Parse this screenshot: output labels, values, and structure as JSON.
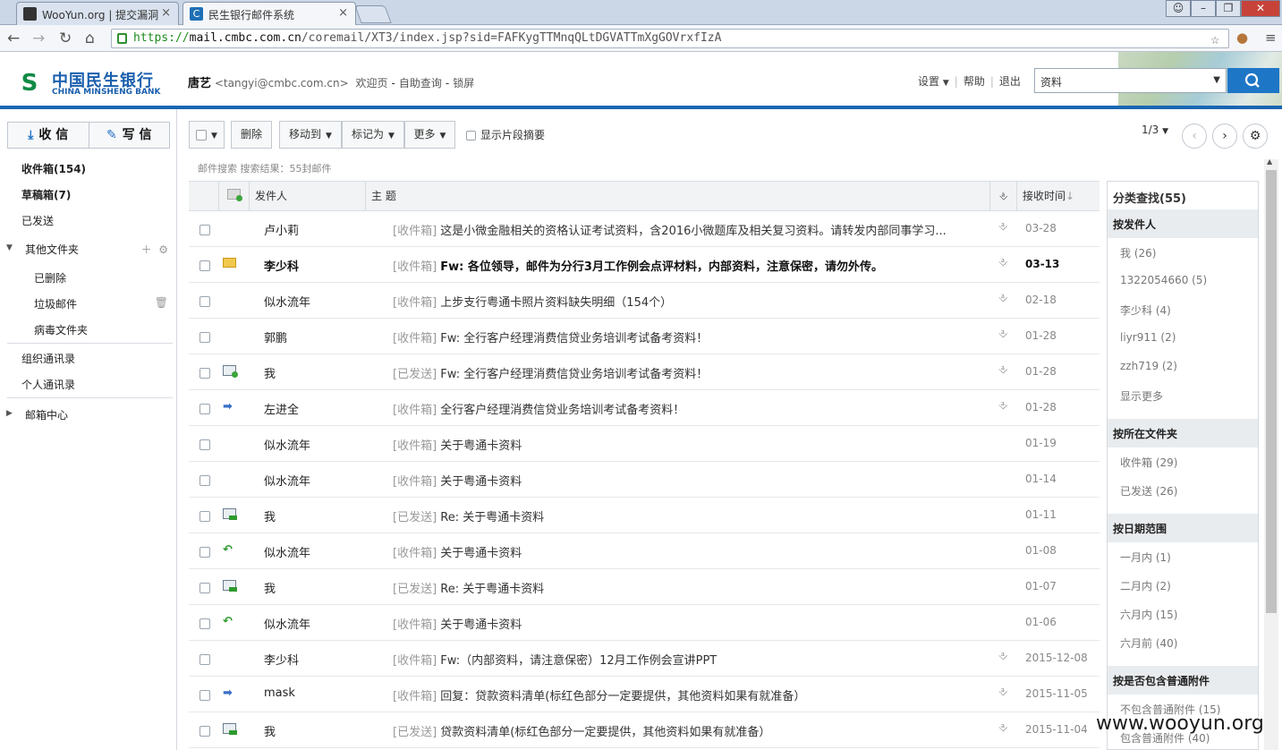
{
  "browser": {
    "tabs": [
      {
        "title": "WooYun.org | 提交漏洞"
      },
      {
        "title": "民生银行邮件系统"
      }
    ],
    "url_scheme": "https://",
    "url_host": "mail.cmbc.com.cn",
    "url_path": "/coremail/XT3/index.jsp?sid=FAFKygTTMnqQLtDGVATTmXgGOVrxfIzA"
  },
  "header": {
    "logo_cn": "中国民生银行",
    "logo_en": "CHINA MINSHENG BANK",
    "user_name": "唐艺",
    "user_email": "<tangyi@cmbc.com.cn>",
    "links": [
      "欢迎页",
      "自助查询",
      "锁屏"
    ],
    "settings": "设置",
    "help": "帮助",
    "logout": "退出",
    "search_value": "资料"
  },
  "sidebar": {
    "receive": "收 信",
    "compose": "写 信",
    "inbox": "收件箱",
    "inbox_count": "(154)",
    "drafts": "草稿箱",
    "drafts_count": "(7)",
    "sent": "已发送",
    "other_folders": "其他文件夹",
    "deleted": "已删除",
    "junk": "垃圾邮件",
    "virus": "病毒文件夹",
    "org_contacts": "组织通讯录",
    "personal_contacts": "个人通讯录",
    "mail_center": "邮箱中心"
  },
  "toolbar": {
    "delete": "删除",
    "move_to": "移动到",
    "mark_as": "标记为",
    "more": "更多",
    "show_snippet": "显示片段摘要",
    "page": "1/3",
    "search_info": "邮件搜索  搜索结果：55封邮件"
  },
  "grid": {
    "col_sender": "发件人",
    "col_subject": "主  题",
    "col_time": "接收时间",
    "rows": [
      {
        "status": "none",
        "sender": "卢小莉",
        "folder": "[收件箱]",
        "subject": "这是小微金融相关的资格认证考试资料，含2016小微题库及相关复习资料。请转发内部同事学习...",
        "att": true,
        "date": "03-28",
        "bold": false
      },
      {
        "status": "unread",
        "sender": "李少科",
        "folder": "[收件箱]",
        "subject": "Fw: 各位领导，邮件为分行3月工作例会点评材料，内部资料，注意保密，请勿外传。",
        "att": true,
        "date": "03-13",
        "bold": true
      },
      {
        "status": "none",
        "sender": "似水流年",
        "folder": "[收件箱]",
        "subject": "上步支行粤通卡照片资料缺失明细（154个）",
        "att": true,
        "date": "02-18",
        "bold": false
      },
      {
        "status": "none",
        "sender": "郭鹏",
        "folder": "[收件箱]",
        "subject": "Fw: 全行客户经理消费信贷业务培训考试备考资料！",
        "att": true,
        "date": "01-28",
        "bold": false
      },
      {
        "status": "sent",
        "sender": "我",
        "folder": "[已发送]",
        "subject": "Fw: 全行客户经理消费信贷业务培训考试备考资料！",
        "att": true,
        "date": "01-28",
        "bold": false
      },
      {
        "status": "forward",
        "sender": "左进全",
        "folder": "[收件箱]",
        "subject": "全行客户经理消费信贷业务培训考试备考资料！",
        "att": true,
        "date": "01-28",
        "bold": false
      },
      {
        "status": "none",
        "sender": "似水流年",
        "folder": "[收件箱]",
        "subject": "关于粤通卡资料",
        "att": false,
        "date": "01-19",
        "bold": false
      },
      {
        "status": "none",
        "sender": "似水流年",
        "folder": "[收件箱]",
        "subject": "关于粤通卡资料",
        "att": false,
        "date": "01-14",
        "bold": false
      },
      {
        "status": "fwsent",
        "sender": "我",
        "folder": "[已发送]",
        "subject": "Re: 关于粤通卡资料",
        "att": false,
        "date": "01-11",
        "bold": false
      },
      {
        "status": "reply",
        "sender": "似水流年",
        "folder": "[收件箱]",
        "subject": "关于粤通卡资料",
        "att": false,
        "date": "01-08",
        "bold": false
      },
      {
        "status": "fwsent",
        "sender": "我",
        "folder": "[已发送]",
        "subject": "Re: 关于粤通卡资料",
        "att": false,
        "date": "01-07",
        "bold": false
      },
      {
        "status": "reply",
        "sender": "似水流年",
        "folder": "[收件箱]",
        "subject": "关于粤通卡资料",
        "att": false,
        "date": "01-06",
        "bold": false
      },
      {
        "status": "none",
        "sender": "李少科",
        "folder": "[收件箱]",
        "subject": "Fw:（内部资料，请注意保密）12月工作例会宣讲PPT",
        "att": true,
        "date": "2015-12-08",
        "bold": false
      },
      {
        "status": "forward",
        "sender": "mask",
        "folder": "[收件箱]",
        "subject": "回复：贷款资料清单(标红色部分一定要提供，其他资料如果有就准备）",
        "att": true,
        "date": "2015-11-05",
        "bold": false
      },
      {
        "status": "fwsent",
        "sender": "我",
        "folder": "[已发送]",
        "subject": "贷款资料清单(标红色部分一定要提供，其他资料如果有就准备）",
        "att": true,
        "date": "2015-11-04",
        "bold": false
      }
    ]
  },
  "facet": {
    "title": "分类查找(55)",
    "groups": [
      {
        "label": "按发件人",
        "items": [
          "我 (26)",
          "1322054660 (5)",
          "李少科 (4)",
          "liyr911 (2)",
          "zzh719 (2)",
          "显示更多"
        ]
      },
      {
        "label": "按所在文件夹",
        "items": [
          "收件箱 (29)",
          "已发送 (26)"
        ]
      },
      {
        "label": "按日期范围",
        "items": [
          "一月内 (1)",
          "二月内 (2)",
          "六月内 (15)",
          "六月前 (40)"
        ]
      },
      {
        "label": "按是否包含普通附件",
        "items": [
          "不包含普通附件 (15)",
          "包含普通附件 (40)"
        ]
      }
    ]
  },
  "watermark": "www.wooyun.org"
}
